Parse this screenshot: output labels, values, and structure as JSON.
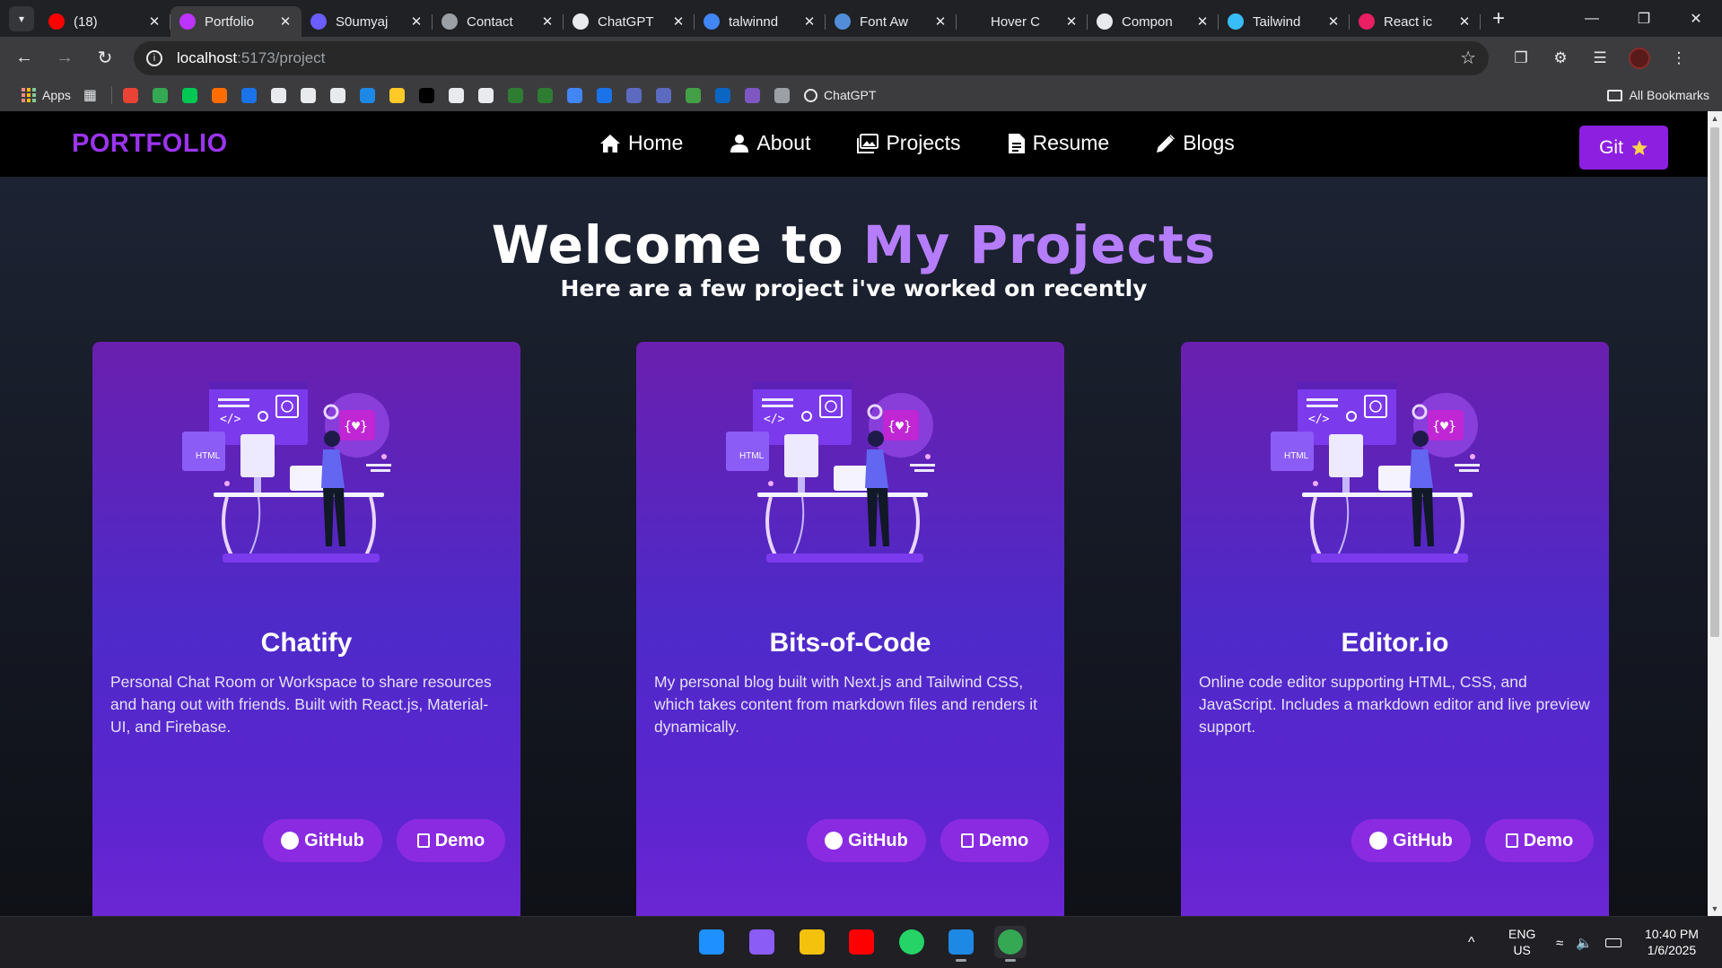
{
  "browser": {
    "tabs": [
      {
        "title": "(18)",
        "favicon": "youtube-icon",
        "color": "#ff0000",
        "active": false
      },
      {
        "title": "Portfolio",
        "favicon": "vite-icon",
        "color": "#bd34fe",
        "active": true
      },
      {
        "title": "S0umyaj",
        "favicon": "s0umyaj-icon",
        "color": "#6b5cff",
        "active": false
      },
      {
        "title": "Contact",
        "favicon": "contact-icon",
        "color": "#9aa0a6",
        "active": false
      },
      {
        "title": "ChatGPT",
        "favicon": "chatgpt-icon",
        "color": "#e8eaed",
        "active": false
      },
      {
        "title": "talwinnd",
        "favicon": "google-icon",
        "color": "#4285f4",
        "active": false
      },
      {
        "title": "Font Aw",
        "favicon": "fontawesome-icon",
        "color": "#528dd7",
        "active": false
      },
      {
        "title": "Hover C",
        "favicon": "blank-icon",
        "color": "#202124",
        "active": false
      },
      {
        "title": "Compon",
        "favicon": "terminal-icon",
        "color": "#e8eaed",
        "active": false
      },
      {
        "title": "Tailwind",
        "favicon": "tailwind-icon",
        "color": "#38bdf8",
        "active": false
      },
      {
        "title": "React ic",
        "favicon": "react-icon",
        "color": "#e91e63",
        "active": false
      }
    ],
    "url_host": "localhost",
    "url_path": ":5173/project",
    "bookmarks": {
      "apps_label": "Apps",
      "chatgpt_label": "ChatGPT",
      "all_label": "All Bookmarks",
      "icons": [
        "#ea4335",
        "#34a853",
        "#00c853",
        "#ff6d00",
        "#1a73e8",
        "#e8eaed",
        "#e8eaed",
        "#e8eaed",
        "#1e88e5",
        "#ffca28",
        "#000000",
        "#e8eaed",
        "#e8eaed",
        "#2e7d32",
        "#2e7d32",
        "#4285f4",
        "#1a73e8",
        "#5c6bc0",
        "#5c6bc0",
        "#43a047",
        "#0a66c2",
        "#7e57c2",
        "#9aa0a6"
      ]
    }
  },
  "site": {
    "logo": "PORTFOLIO",
    "menu": [
      {
        "label": "Home",
        "icon": "home-icon"
      },
      {
        "label": "About",
        "icon": "user-icon"
      },
      {
        "label": "Projects",
        "icon": "image-icon"
      },
      {
        "label": "Resume",
        "icon": "document-icon"
      },
      {
        "label": "Blogs",
        "icon": "pencil-icon"
      }
    ],
    "git_label": "Git",
    "hero_title_plain": "Welcome to ",
    "hero_title_accent": "My Projects",
    "hero_subtitle": "Here are a few project i've worked on recently",
    "projects": [
      {
        "title": "Chatify",
        "description": "Personal Chat Room or Workspace to share resources and hang out with friends. Built with React.js, Material-UI, and Firebase.",
        "github_label": "GitHub",
        "demo_label": "Demo"
      },
      {
        "title": "Bits-of-Code",
        "description": "My personal blog built with Next.js and Tailwind CSS, which takes content from markdown files and renders it dynamically.",
        "github_label": "GitHub",
        "demo_label": "Demo"
      },
      {
        "title": "Editor.io",
        "description": "Online code editor supporting HTML, CSS, and JavaScript. Includes a markdown editor and live preview support.",
        "github_label": "GitHub",
        "demo_label": "Demo"
      }
    ],
    "colors": {
      "accent": "#9b34ef",
      "button": "#8d1fe0"
    }
  },
  "taskbar": {
    "apps": [
      "windows-start-icon",
      "copilot-icon",
      "file-explorer-icon",
      "youtube-icon",
      "whatsapp-icon",
      "vscode-icon",
      "chrome-icon"
    ],
    "lang_line1": "ENG",
    "lang_line2": "US",
    "time": "10:40 PM",
    "date": "1/6/2025"
  }
}
